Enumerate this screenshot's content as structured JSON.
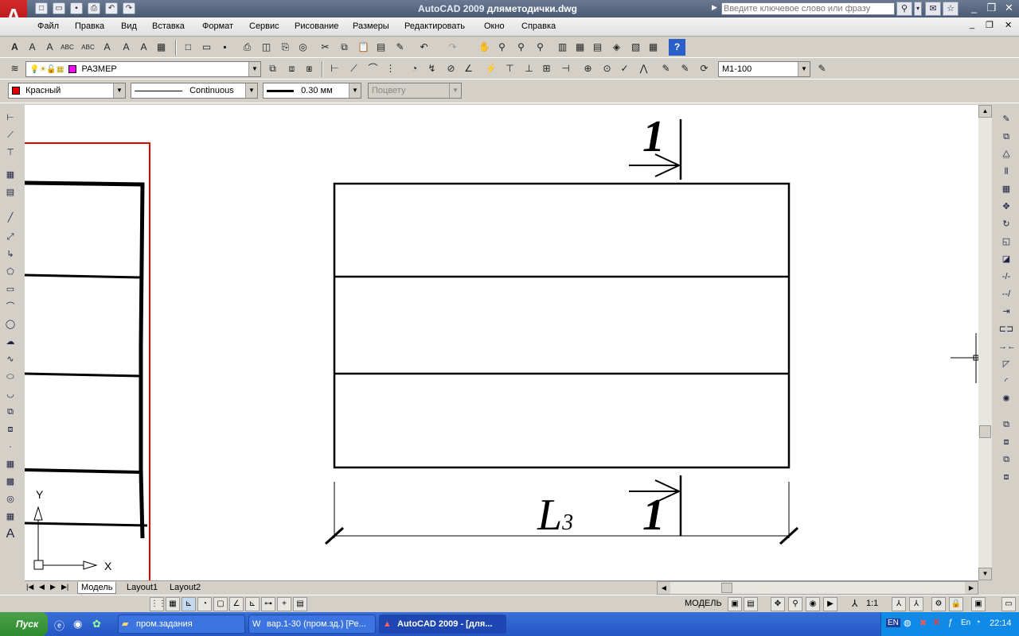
{
  "window": {
    "app_title": "AutoCAD 2009",
    "doc_title": "дляметодички.dwg",
    "search_placeholder": "Введите ключевое слово или фразу"
  },
  "menu": [
    "Файл",
    "Правка",
    "Вид",
    "Вставка",
    "Формат",
    "Сервис",
    "Рисование",
    "Размеры",
    "Редактировать",
    "Окно",
    "Справка"
  ],
  "layers": {
    "current_layer": "РАЗМЕР",
    "color": "Красный",
    "linetype": "Continuous",
    "lineweight": "0.30 мм",
    "plotstyle": "Поцвету",
    "dimstyle": "М1-100"
  },
  "drawing": {
    "dim_label_L": "L",
    "dim_label_sub": "3",
    "section_mark_top": "1",
    "section_mark_bottom": "1",
    "ucs_y": "Y",
    "ucs_x": "X"
  },
  "tabs": [
    "Модель",
    "Layout1",
    "Layout2"
  ],
  "status": {
    "space": "МОДЕЛЬ",
    "scale": "1:1"
  },
  "taskbar": {
    "start": "Пуск",
    "tasks": [
      "пром.задания",
      "вар.1-30 (пром.зд.) [Ре...",
      "AutoCAD 2009 - [для..."
    ],
    "lang": "EN",
    "clock": "22:14"
  },
  "colors": {
    "red": "#e00000",
    "title_bg": "#4b5a74"
  }
}
